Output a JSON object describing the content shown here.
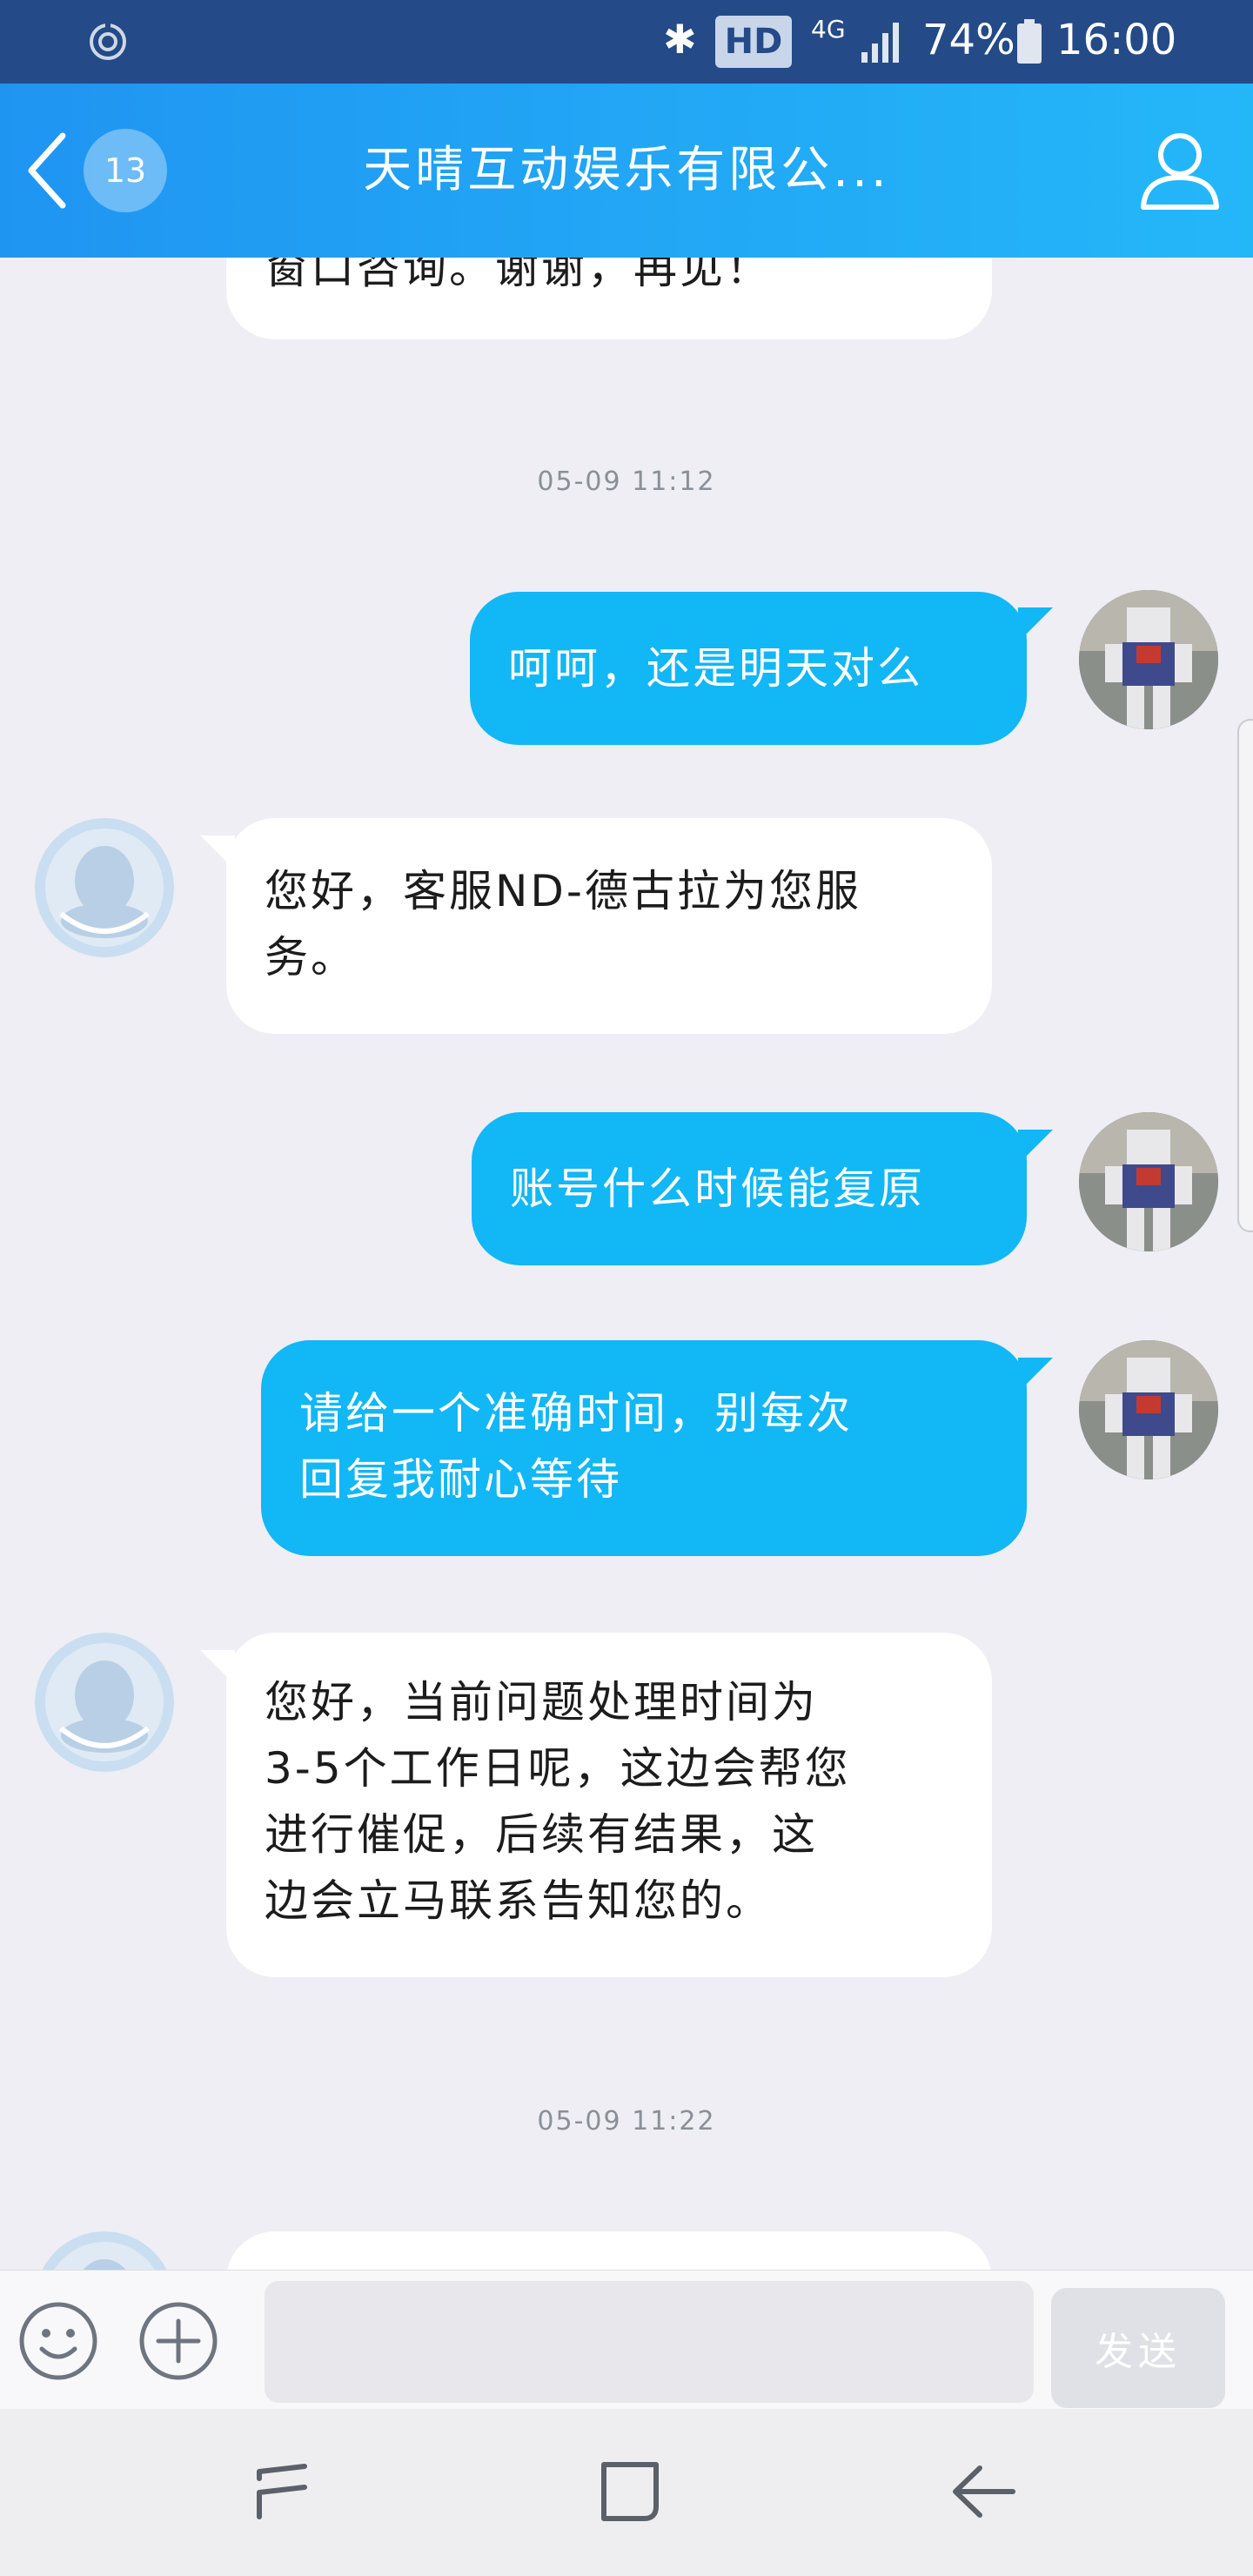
{
  "status_bar": {
    "network_label": "HD",
    "network_type": "4G",
    "battery": "74%",
    "time": "16:00",
    "icons": [
      "sync-icon",
      "bluetooth-icon",
      "signal-icon",
      "battery-icon"
    ]
  },
  "header": {
    "unread_count": "13",
    "title": "天晴互动娱乐有限公...",
    "icons": [
      "back-arrow-icon",
      "user-profile-icon"
    ]
  },
  "messages": [
    {
      "type": "incoming",
      "text": "窗口咨询。谢谢，再见！"
    },
    {
      "type": "timestamp",
      "text": "05-09 11:12"
    },
    {
      "type": "outgoing",
      "text": "呵呵，还是明天对么"
    },
    {
      "type": "incoming",
      "text": "您好，客服ND-德古拉为您服\n务。"
    },
    {
      "type": "outgoing",
      "text": "账号什么时候能复原"
    },
    {
      "type": "outgoing",
      "text": "请给一个准确时间，别每次\n回复我耐心等待"
    },
    {
      "type": "incoming",
      "text": "您好，当前问题处理时间为\n3-5个工作日呢，这边会帮您\n进行催促，后续有结果，这\n边会立马联系告知您的。"
    },
    {
      "type": "timestamp",
      "text": "05-09 11:22"
    }
  ],
  "input_bar": {
    "placeholder": "",
    "send_label": "发送",
    "icons": [
      "emoji-icon",
      "add-icon"
    ]
  },
  "nav_bar": {
    "icons": [
      "recent-apps-icon",
      "home-icon",
      "back-icon"
    ]
  },
  "colors": {
    "status_bar": "#244a87",
    "header_gradient_start": "#1f95f2",
    "header_gradient_end": "#24b7f8",
    "outgoing_bubble": "#12b7f5",
    "incoming_bubble": "#ffffff",
    "chat_background": "#eeeef4"
  }
}
